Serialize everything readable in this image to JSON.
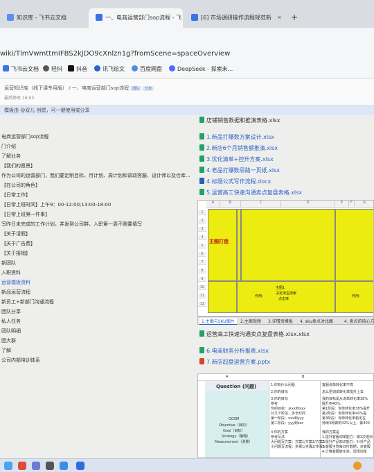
{
  "tabs": [
    {
      "label": "知识库 - 飞书云文档",
      "active": false
    },
    {
      "label": "一、电商运营部门sop流程 - 飞",
      "active": true
    },
    {
      "label": "[6] 市场调研操作流程规范新",
      "active": false
    }
  ],
  "new_tab": "+",
  "url": "wiki/TlmVwmttmIFBS2kJDO9cXnlzn1g?fromScene=spaceOverview",
  "bookmarks": [
    "飞书云文档",
    "轻抖",
    "抖音",
    "讯飞绘文",
    "百度网盘",
    "DeepSeek - 探索未..."
  ],
  "breadcrumb": "运营知识库（线下课专用版） / 一、电商运营部门sop流程",
  "breadcrumb_tags": [
    "团队",
    "分享"
  ],
  "date": "最后修改 16:03",
  "banner": "模板由 @双儿 创建，可一键使用或分享",
  "outline": [
    "电商运营部门sop流程",
    "门介绍",
    "了解业务",
    "【我们的愿景】",
    "作为公司的运营部门，我们要定制目标、月计划、周计划和调动客服、设计师以及仓库...",
    "【在公司的角色】",
    "【日常工作】",
    "【日常上班时间】上午9：00-12:00;13:00-18:00",
    "【日常上班第一件事】",
    "写昨日未完成的工作计划，并发到公司群，入职第一周不需要填写",
    "【关于请假】",
    "【关于广告费】",
    "【关于报销】",
    "新团队",
    "入职资料",
    "运营模板资料",
    "新品运营流程",
    "新员工+新部门沟通流程",
    "团队分享",
    "私人任务",
    "团队明细",
    "团大群",
    "了解",
    "公司内部培训体系"
  ],
  "files_top": [
    "店铺销售数据和推演表格.xlsx",
    "1.新品打爆数方案设计.xlsx",
    "2.新店6个月销售额推演.xlsx",
    "3.优化清单+控升方案.xlsx",
    "4.老品打爆数思路一页纸.xlsx",
    "4.标题公式写作流程.docx",
    "5.运营高工快速沟通卖点复盘表格.xlsx"
  ],
  "sheet": {
    "cols": [
      "A",
      "B",
      "C",
      "D",
      "E",
      "F",
      "G"
    ],
    "rows": [
      "1",
      "2",
      "3",
      "4",
      "5",
      "6",
      "7",
      "8",
      "9",
      "10",
      "11",
      "12",
      "13",
      "14",
      "15",
      "16"
    ],
    "main_label": "主图打造",
    "cells": [
      "主图1",
      "决定淘宝搜索",
      "点击率",
      "作用:",
      "作用:"
    ]
  },
  "sheet_tabs": [
    "1.主图与SKU图片",
    "2.主图视频",
    "3.详情页模板",
    "4. sku卖点对比图",
    "4. 卖点的核心方式"
  ],
  "files_mid": [
    "运营高工快速沟通卖点复盘表格.xlsx.xlsx"
  ],
  "files_bottom": [
    "6.电商财务分析报表.xlsx",
    "7.新店起盘运营方案.pptx"
  ],
  "table2": {
    "cols": [
      "A",
      "B"
    ],
    "question": "Question (问题)",
    "lines": [
      "1.你有什么问题",
      "2.你的目标",
      "3.你的目标",
      "参考",
      "你的目标：从xx到xxx",
      "分几个阶段，多长时间",
      "第一阶段：xxx到yyy",
      "第二阶段：yyy到zzz",
      "4.你的方案",
      "参考写法",
      "大问题写方案：方案1/方案2/方案3",
      "小问题写流程：步骤1/步骤2/步骤3"
    ],
    "right_lines": [
      "客服询单转化率不高",
      "怎么把询单转化率提升上去",
      "我的目标是从询单转化率38%",
      "提升到40%。",
      "第1阶段：询单转化率38%提升",
      "第2阶段：询单转化率40%提",
      "第3阶段：询单转化率稳定在",
      "持续3周做到42%以上，做400",
      "我的方案是",
      "1.提升客服询单能力：做1次培训",
      "2.提升产品知识能力：针对产品",
      "3.客服主管每日打数据，对客服",
      "4.计算客服转化率，选择询单"
    ],
    "ogsm": [
      "OGSM",
      "Objective（目的）",
      "Goal（目标）",
      "Strategy（策略）",
      "Measurement（测量）"
    ]
  }
}
